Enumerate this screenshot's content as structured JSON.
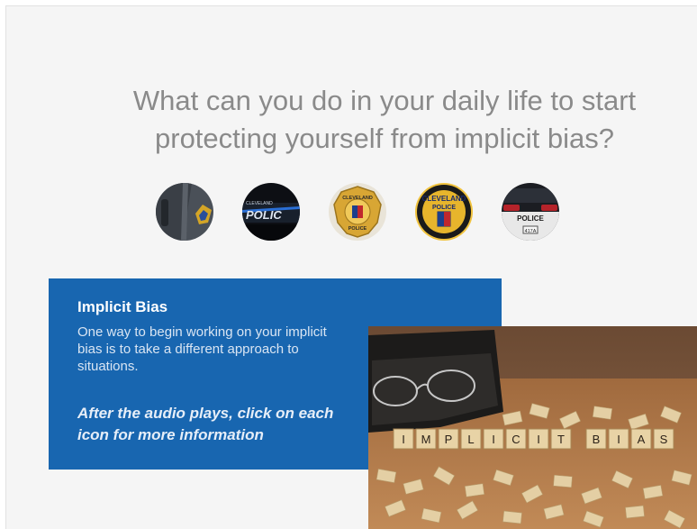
{
  "slide": {
    "title": "What can you do in your daily life to start protecting yourself from implicit bias?"
  },
  "icons": [
    {
      "name": "officer-shoulder-patch-icon"
    },
    {
      "name": "police-car-door-icon"
    },
    {
      "name": "cleveland-police-badge-icon",
      "badge_top": "CLEVELAND",
      "badge_bottom": "POLICE"
    },
    {
      "name": "cleveland-police-patch-icon",
      "patch_top": "CLEVELAND",
      "patch_bottom": "POLICE"
    },
    {
      "name": "police-car-rear-icon",
      "plate": "417A",
      "word": "POLICE"
    }
  ],
  "info_box": {
    "heading": "Implicit Bias",
    "body": "One way to begin working on your implicit bias is to take a different approach to situations.",
    "instruction": "After the audio plays,  click on each icon for more information"
  },
  "photo": {
    "tiles_word_1": [
      "I",
      "M",
      "P",
      "L",
      "I",
      "C",
      "I",
      "T"
    ],
    "tiles_word_2": [
      "B",
      "I",
      "A",
      "S"
    ]
  },
  "colors": {
    "slide_bg": "#f5f5f5",
    "title": "#8a8a8a",
    "info_box_bg": "#1866b0",
    "info_text": "#d9e5f3",
    "wood": "#b9804f"
  }
}
